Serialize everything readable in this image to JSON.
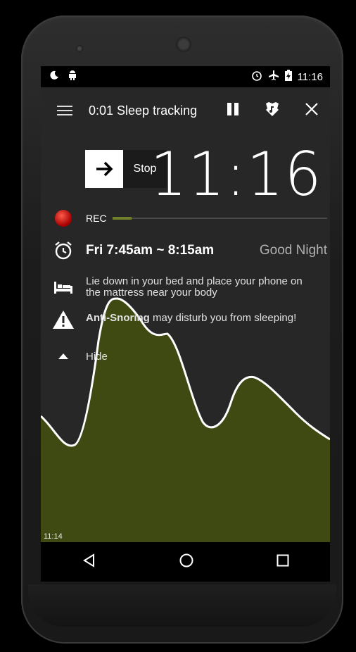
{
  "status_bar": {
    "time": "11:16",
    "left_icons": [
      "moon-icon",
      "android-icon"
    ],
    "right_icons": [
      "alarm-clock-icon",
      "airplane-icon",
      "battery-charging-icon"
    ]
  },
  "app_bar": {
    "title": "0:01 Sleep tracking",
    "actions": [
      "pause-icon",
      "lullaby-icon",
      "close-icon"
    ]
  },
  "stop_button": {
    "label": "Stop"
  },
  "clock": {
    "time": "11:16"
  },
  "recording": {
    "label": "REC",
    "progress": 0.09
  },
  "alarm": {
    "range": "Fri 7:45am ~ 8:15am",
    "greeting": "Good Night"
  },
  "tip": {
    "text": "Lie down in your bed and place your phone on the mattress near your body"
  },
  "warning": {
    "bold": "Anti-Snoring",
    "text": " may disturb you from sleeping!"
  },
  "hide": {
    "label": "Hide"
  },
  "chart_data": {
    "type": "area",
    "start_time_label": "11:14",
    "fill_color": "#3f4a12",
    "line_color": "#ffffff"
  },
  "navbar": {
    "buttons": [
      "back-icon",
      "home-icon",
      "recents-icon"
    ]
  }
}
